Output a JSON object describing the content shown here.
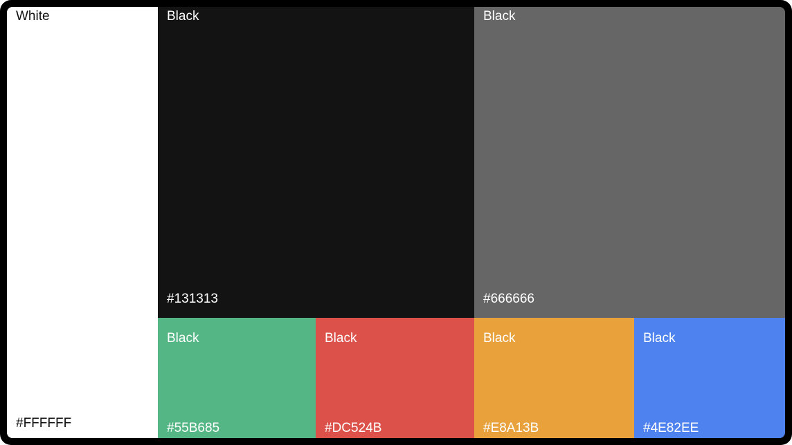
{
  "palette": {
    "white": {
      "name": "White",
      "hex": "#FFFFFF",
      "color": "#FFFFFF"
    },
    "black": {
      "name": "Black",
      "hex": "#131313",
      "color": "#131313"
    },
    "gray": {
      "name": "Black",
      "hex": "#666666",
      "color": "#666666"
    },
    "green": {
      "name": "Black",
      "hex": "#55B685",
      "color": "#55B685"
    },
    "red": {
      "name": "Black",
      "hex": "#DC524B",
      "color": "#DC524B"
    },
    "orange": {
      "name": "Black",
      "hex": "#E8A13B",
      "color": "#E8A13B"
    },
    "blue": {
      "name": "Black",
      "hex": "#4E82EE",
      "color": "#4E82EE"
    }
  }
}
